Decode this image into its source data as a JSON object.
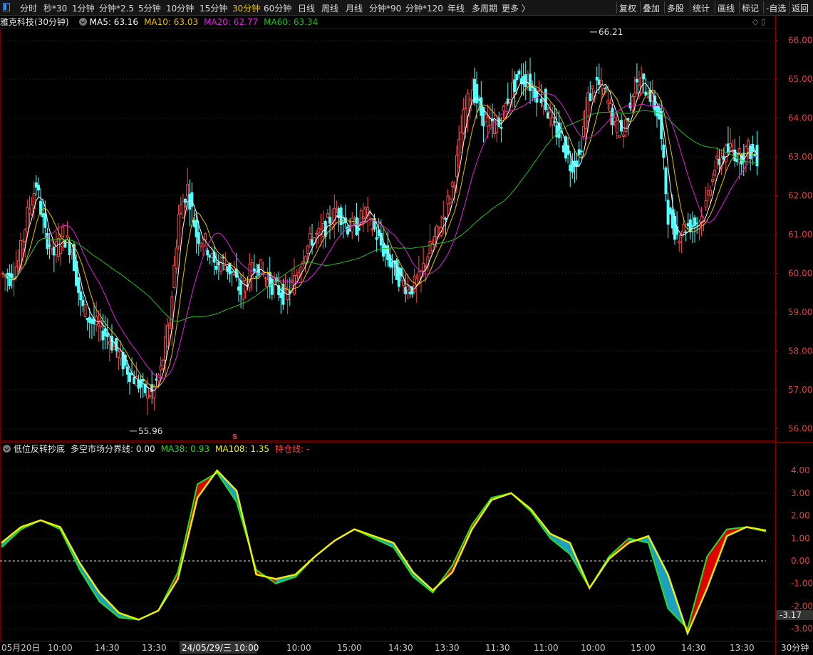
{
  "toolbar": {
    "left_items": [
      {
        "label": "分时",
        "active": false
      },
      {
        "label": "秒*30",
        "active": false
      },
      {
        "label": "1分钟",
        "active": false
      },
      {
        "label": "分钟*2.5",
        "active": false
      },
      {
        "label": "5分钟",
        "active": false
      },
      {
        "label": "10分钟",
        "active": false
      },
      {
        "label": "15分钟",
        "active": false
      },
      {
        "label": "30分钟",
        "active": true
      },
      {
        "label": "60分钟",
        "active": false
      },
      {
        "label": "日线",
        "active": false
      },
      {
        "label": "周线",
        "active": false
      },
      {
        "label": "月线",
        "active": false
      },
      {
        "label": "分钟*90",
        "active": false
      },
      {
        "label": "分钟*120",
        "active": false
      },
      {
        "label": "年线",
        "active": false
      },
      {
        "label": "多周期",
        "active": false
      },
      {
        "label": "更多 〉",
        "active": false
      }
    ],
    "right_items": [
      {
        "label": "复权"
      },
      {
        "label": "叠加"
      },
      {
        "label": "多股"
      },
      {
        "label": "统计"
      },
      {
        "label": "画线"
      },
      {
        "label": "标记"
      },
      {
        "label": "-自选"
      },
      {
        "label": "返回"
      }
    ]
  },
  "main_header": {
    "stock": "雅克科技(30分钟)",
    "ma5": "MA5: 63.16",
    "ma10": "MA10: 63.03",
    "ma20": "MA20: 62.77",
    "ma60": "MA60: 63.34"
  },
  "indicator_header": {
    "name": "低位反转抄底",
    "divider": "多空市场分界线: 0.00",
    "ma38": "MA38: 0.93",
    "ma108": "MA108: 1.35",
    "hold": "持仓线: -"
  },
  "bottom_axis": {
    "labels": [
      "05月20日",
      "10:00",
      "14:30",
      "13:30",
      "24/05/29/三 10:00",
      "10:00",
      "15:00",
      "14:30",
      "13:30",
      "11:30",
      "11:00",
      "10:00",
      "15:00",
      "14:30",
      "13:30"
    ],
    "period_label": "30分钟"
  },
  "colors": {
    "background": "#000000",
    "up": "#ff4a4a",
    "down": "#54ffff",
    "ma5": "#ffffff",
    "ma10": "#e8c000",
    "ma20": "#e020e0",
    "ma60": "#20c020",
    "osc_up": "#e00000",
    "osc_down": "#20a0c0",
    "osc_line": "#f0f000",
    "osc_green": "#20e020",
    "grid": "#6a0000"
  },
  "chart_data": {
    "type": "candlestick",
    "price_axis": {
      "ylim": [
        55.7,
        66.3
      ],
      "ticks": [
        "56.00",
        "57.00",
        "58.00",
        "59.00",
        "60.00",
        "61.00",
        "62.00",
        "63.00",
        "64.00",
        "65.00",
        "66.00"
      ]
    },
    "annotations": [
      {
        "text": "55.96",
        "price": 55.96
      },
      {
        "text": "66.21",
        "price": 66.21
      },
      {
        "text": "S"
      }
    ],
    "close_prices": [
      60.0,
      59.9,
      60.3,
      61.5,
      62.3,
      61.0,
      60.5,
      61.0,
      60.6,
      59.2,
      58.8,
      58.6,
      58.4,
      58.0,
      57.6,
      57.3,
      57.0,
      56.9,
      57.5,
      58.8,
      61.5,
      62.2,
      61.0,
      60.8,
      60.2,
      60.3,
      60.0,
      59.5,
      60.0,
      60.2,
      59.8,
      59.6,
      59.4,
      59.8,
      60.5,
      60.9,
      61.0,
      61.4,
      61.6,
      61.2,
      61.2,
      61.6,
      61.1,
      60.6,
      60.2,
      59.8,
      59.6,
      59.8,
      60.5,
      61.0,
      61.6,
      62.5,
      64.0,
      64.8,
      64.1,
      63.8,
      63.8,
      64.5,
      65.0,
      65.0,
      64.7,
      64.5,
      63.8,
      63.5,
      62.8,
      63.0,
      64.5,
      64.9,
      64.6,
      63.8,
      63.6,
      64.7,
      64.9,
      64.6,
      64.0,
      61.5,
      61.0,
      61.2,
      61.3,
      61.5,
      62.6,
      63.0,
      63.2,
      63.0,
      63.2,
      63.0
    ],
    "indicator_axis": {
      "ylim": [
        -3.5,
        4.7
      ],
      "ticks": [
        "4.00",
        "3.00",
        "2.00",
        "1.00",
        "0.00",
        "-1.00",
        "-2.00",
        "-3.00"
      ],
      "current_label": "-3.17"
    },
    "indicator_series": [
      {
        "name": "MA38",
        "values": [
          0.6,
          1.4,
          1.8,
          1.4,
          -0.4,
          -1.8,
          -2.5,
          -2.6,
          -2.2,
          -0.5,
          3.4,
          3.9,
          2.6,
          -0.4,
          -1.0,
          -0.7,
          0.2,
          0.9,
          1.4,
          1.0,
          0.6,
          -0.7,
          -1.4,
          -0.2,
          1.6,
          2.8,
          3.0,
          2.2,
          1.0,
          0.3,
          -1.2,
          0.2,
          1.0,
          0.8,
          -2.1,
          -3.0,
          0.2,
          1.4,
          1.5,
          1.3
        ]
      },
      {
        "name": "MA108",
        "values": [
          0.8,
          1.5,
          1.8,
          1.5,
          -0.1,
          -1.4,
          -2.3,
          -2.6,
          -2.2,
          -0.8,
          2.8,
          4.0,
          3.1,
          -0.6,
          -0.8,
          -0.6,
          0.2,
          0.9,
          1.4,
          1.1,
          0.8,
          -0.5,
          -1.3,
          -0.5,
          1.4,
          2.7,
          3.0,
          2.3,
          1.2,
          0.8,
          -1.2,
          0.1,
          0.8,
          1.1,
          -0.6,
          -3.2,
          -1.2,
          1.1,
          1.5,
          1.35
        ]
      }
    ],
    "divider_value": 0.0
  }
}
